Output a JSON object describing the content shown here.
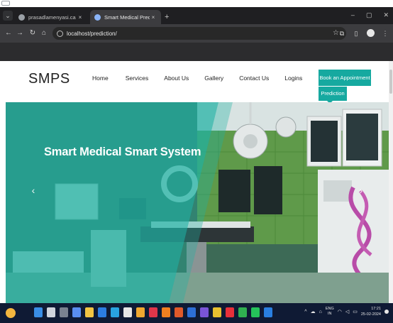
{
  "browser": {
    "tabs": [
      {
        "title": "prasadlamenyasi.ca",
        "active": false
      },
      {
        "title": "Smart Medical Prediction Syste",
        "active": true
      }
    ],
    "new_tab_symbol": "+",
    "tab_close_symbol": "×",
    "window_controls": [
      "–",
      "▢",
      "✕"
    ],
    "address": "localhost/prediction/",
    "nav_icons": [
      "back-icon",
      "forward-icon",
      "reload-icon",
      "home-icon"
    ]
  },
  "site": {
    "brand": "SMPS",
    "nav": {
      "home": "Home",
      "services": "Services",
      "about": "About Us",
      "gallery": "Gallery",
      "contact": "Contact Us",
      "logins": "Logins"
    },
    "cta_primary": "Book an Appointment",
    "cta_secondary": "Prediction",
    "accent_color": "#16a9a0",
    "hero": {
      "title": "Smart Medical Smart System",
      "prev_arrow": "‹",
      "next_arrow": "›"
    }
  },
  "taskbar": {
    "weather_temp": "32°",
    "language": [
      "ENG",
      "IN"
    ],
    "time": "17:21",
    "date": "25-02-2024",
    "background": "#0f1a34"
  }
}
